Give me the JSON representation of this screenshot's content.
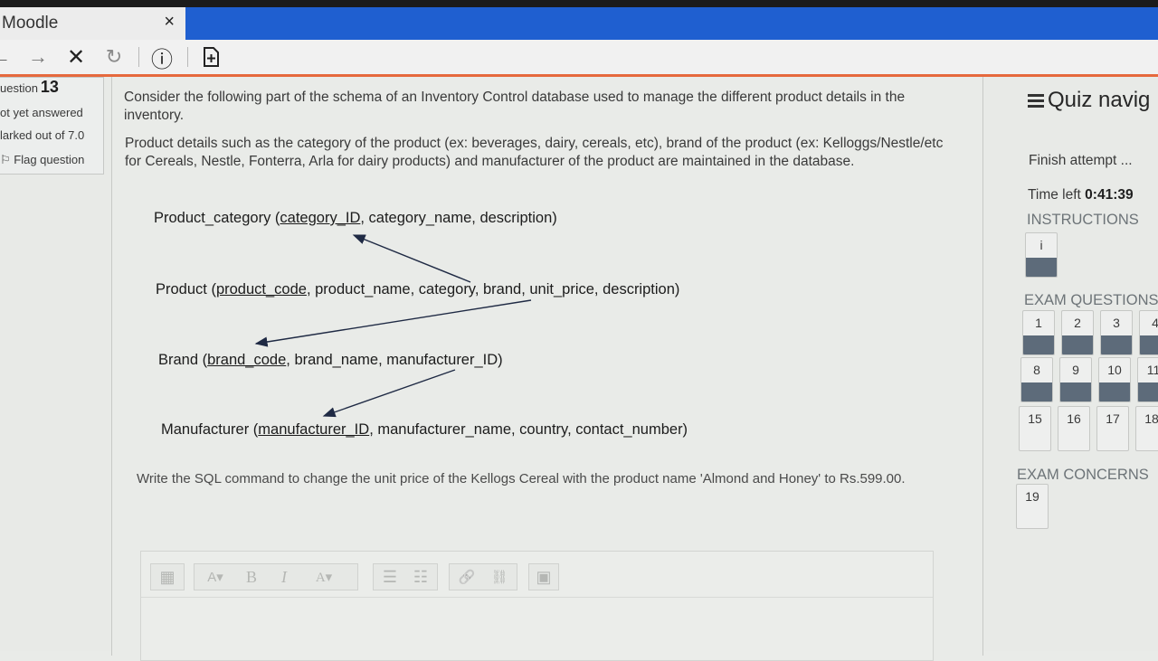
{
  "browser": {
    "tab_title": "Moodle",
    "tab_close": "×",
    "toolbar": {
      "back": "←",
      "forward": "→",
      "stop": "✕",
      "reload": "↻",
      "info": "ⓘ"
    }
  },
  "question_info": {
    "label": "uestion",
    "number": "13",
    "state": "ot yet answered",
    "marks": "larked out of 7.0",
    "flag": "Flag question",
    "flag_icon": "⚐"
  },
  "content": {
    "intro": "Consider the following part of the schema of an Inventory Control database used to manage the different product details in the inventory.",
    "details": "Product details such as the category of the product (ex: beverages, dairy, cereals, etc), brand of the product (ex: Kelloggs/Nestle/etc for Cereals, Nestle, Fonterra, Arla for dairy products) and manufacturer of the product are maintained in the database.",
    "schema": {
      "category": {
        "prefix": "Product_category (",
        "key": "category_ID",
        "rest": ", category_name, description)"
      },
      "product": {
        "prefix": "Product (",
        "key": "product_code",
        "rest": ", product_name, category, brand, unit_price, description)"
      },
      "brand": {
        "prefix": "Brand (",
        "key": "brand_code",
        "rest": ", brand_name, manufacturer_ID)"
      },
      "manufacturer": {
        "prefix": "Manufacturer (",
        "key": "manufacturer_ID",
        "rest": ", manufacturer_name, country, contact_number)"
      }
    },
    "question": "Write the SQL command to change the unit price of the Kellogs Cereal with the product name 'Almond and Honey' to Rs.599.00."
  },
  "editor": {
    "buttons": [
      "▦",
      "A▾",
      "B",
      "I",
      "A▾",
      "☰",
      "☷",
      "🔗",
      "⛓",
      "▣"
    ]
  },
  "nav": {
    "title": "Quiz navig",
    "finish": "Finish attempt ...",
    "time_label": "Time left ",
    "time_value": "0:41:39",
    "instructions": "INSTRUCTIONS",
    "instructions_btn": "i",
    "exam_questions": "EXAM QUESTIONS",
    "q_row1": [
      "1",
      "2",
      "3",
      "4"
    ],
    "q_row2": [
      "8",
      "9",
      "10",
      "11"
    ],
    "q_row3": [
      "15",
      "16",
      "17",
      "18"
    ],
    "exam_concerns": "EXAM CONCERNS",
    "concerns": [
      "19"
    ]
  }
}
